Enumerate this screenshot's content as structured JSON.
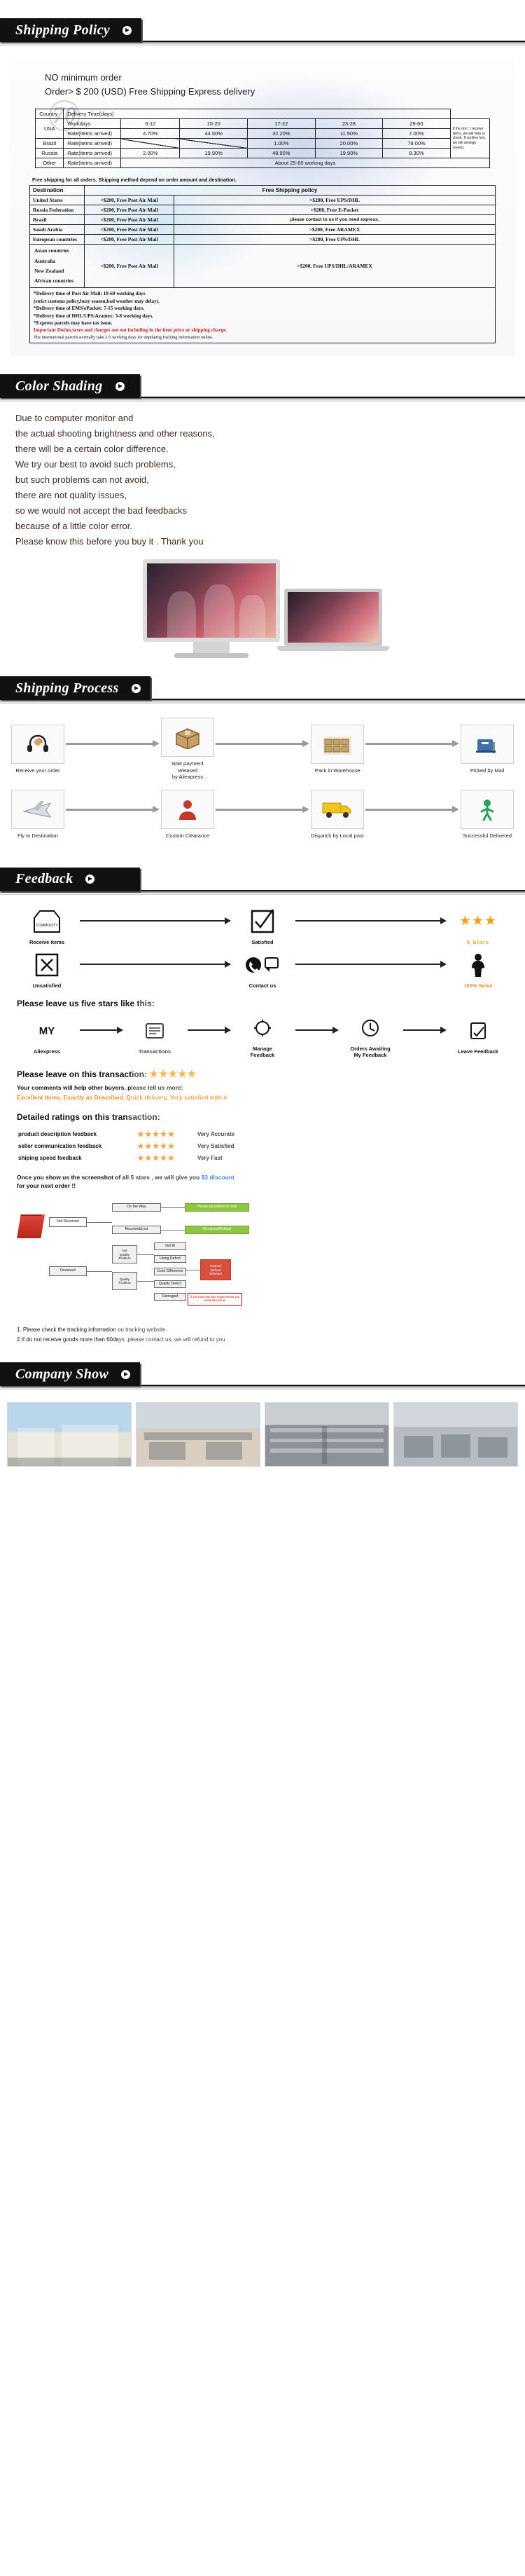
{
  "sections": {
    "shipping_policy": {
      "title": "Shipping Policy"
    },
    "color_shading": {
      "title": "Color Shading"
    },
    "shipping_process": {
      "title": "Shipping Process"
    },
    "feedback": {
      "title": "Feedback"
    },
    "company_show": {
      "title": "Company Show"
    }
  },
  "shipping": {
    "headline_1": "NO minimum order",
    "headline_2": "Order> $ 200 (USD) Free Shipping  Express delivery",
    "watermark_mark": "70",
    "watermark_text": "c w e e l",
    "rates_table": {
      "col_country": "Country",
      "col_delivery": "Delivery   Time(days)",
      "day_buckets": [
        "6-12",
        "10-20",
        "17-22",
        "23-28",
        "29-60"
      ],
      "rows": [
        {
          "country": "",
          "metric": "Workdays",
          "values": [
            "6-12",
            "10-20",
            "17-22",
            "23-28",
            "29-60"
          ]
        },
        {
          "country": "USA",
          "metric": "Rate(items arrived)",
          "values": [
            "4.70%",
            "44.50%",
            "32.20%",
            "11.50%",
            "7.00%"
          ]
        },
        {
          "country": "Brazil",
          "metric": "Rate(items arrived)",
          "values": [
            "",
            "",
            "1.00%",
            "20.00%",
            "79.00%"
          ]
        },
        {
          "country": "Russia",
          "metric": "Rate(items arrived)",
          "values": [
            "2.00%",
            "19.90%",
            "49.90%",
            "19.90%",
            "8.30%"
          ]
        },
        {
          "country": "Other",
          "metric": "Rate(items arrived)",
          "values": [
            "About 25-60 working  days"
          ]
        }
      ],
      "side_note": "If the don ' t receive items, we will help to check, If confirm lost, we will arrange resend."
    },
    "policy_note": "Free shipping for all orders. Shipping method depend on order amount and destination.",
    "policy_table": {
      "col_destination": "Destination",
      "col_policy": "Free Shipping policy",
      "rows": [
        {
          "dest": "United States",
          "under": "<$200, Free Post Air Mail",
          "over": ">$200, Free UPS/DHL"
        },
        {
          "dest": "Russia Federation",
          "under": "<$200, Free Post Air Mail",
          "over": ">$200, Free  E-Packet",
          "over_small": true
        },
        {
          "dest": "Brazil",
          "under": "<$200, Free Post Air Mail",
          "over": "please contact to us if you need express.",
          "over_small": true
        },
        {
          "dest": "Saudi Arabia",
          "under": "<$200, Free Post Air Mail",
          "over": ">$200, Free  ARAMEX"
        },
        {
          "dest": "European countries",
          "under": "<$200, Free Post Air Mail",
          "over": ">$200, Free UPS/DHL"
        },
        {
          "dest": "Asian countries\nAustralia\nNew Zealand\nAfrican countries",
          "under": "<$200, Free Post Air Mail",
          "over": ">$200, Free UPS/DHL/ARAMEX",
          "multi": true
        }
      ]
    },
    "notes": [
      "*Delivery time of Post Air Mail: 10-60 working  days",
      " (strict customs policy,busy season,bad weather may delay).",
      "*Delivery time of EMS/ePacket: 7-15 working days.",
      "*Delivery time of DHL/UPS/Aramex: 3-8 working  days.",
      "*Express parcels may have tax issue."
    ],
    "note_red": "Important Duties,taxes and charges are not including in the item price or shipping charge.",
    "note_thin": "The international parcels normally take 2-5 working days for unpdating tracking information online."
  },
  "color_shading": {
    "lines": [
      "Due to computer monitor and",
      "the actual shooting brightness and other reasons,",
      "there will be a certain color difference.",
      "We try our best to avoid such problems,",
      "but such problems can not avoid,",
      "there are not quality issues,",
      "so we would not accept the bad feedbacks",
      "because of a little color error.",
      "Please know this before you buy it . Thank you"
    ]
  },
  "process": {
    "row1": [
      {
        "icon": "headset-icon",
        "caption": "Receive your order"
      },
      {
        "icon": "package-icon",
        "caption": "Wait payment released\nby Aliexpress"
      },
      {
        "icon": "warehouse-icon",
        "caption": "Pack in Warehouse"
      },
      {
        "icon": "mail-box-icon",
        "caption": "Picked by Mail"
      }
    ],
    "row2": [
      {
        "icon": "airplane-icon",
        "caption": "Fly to Destination"
      },
      {
        "icon": "customs-icon",
        "caption": "Custom Clearance"
      },
      {
        "icon": "truck-icon",
        "caption": "Dispatch by Local post"
      },
      {
        "icon": "delivered-icon",
        "caption": "Successful Delivered"
      }
    ]
  },
  "feedback": {
    "row1": [
      {
        "icon": "receive-items-icon",
        "caption": "Receive items"
      },
      {
        "icon": "satisfied-check-icon",
        "caption": "Satisfied"
      },
      {
        "icon": "three-stars-icon",
        "caption": "5 Stars",
        "stars": "★★★"
      }
    ],
    "row2": [
      {
        "icon": "unsatisfied-icon",
        "caption": "Unsatisfied"
      },
      {
        "icon": "contact-phone-icon",
        "caption": "Contact us"
      },
      {
        "icon": "solve-icon",
        "caption": "100% Solve"
      }
    ],
    "leave_five": "Please leave us five stars like this:",
    "five_steps": [
      {
        "icon": "my-aliexpress-icon",
        "top": "MY",
        "label": "Aliexpress"
      },
      {
        "icon": "transactions-icon",
        "label": "Transactions"
      },
      {
        "icon": "manage-feedback-icon",
        "label": "Manage\nFeedback"
      },
      {
        "icon": "orders-awaiting-icon",
        "label": "Orders Awaiting\nMy Feedback"
      },
      {
        "icon": "leave-feedback-icon",
        "label": "Leave Feedback"
      }
    ],
    "transaction_title": "Please leave on this transaction:",
    "transaction_stars": "★★★★★",
    "comments_hint": "Your comments will help other buyers, please tell us more:",
    "comments_example": "Excellent items, Exactly as Described, Quick delivery, Very satisfied with it",
    "ratings_title": "Detailed ratings on this transaction:",
    "ratings": [
      {
        "label": "product description feedback",
        "stars": "★★★★★",
        "value": "Very Accurate"
      },
      {
        "label": "seller communication feedback",
        "stars": "★★★★★",
        "value": "Very Satisfied"
      },
      {
        "label": "shiping speed feedback",
        "stars": "★★★★★",
        "value": "Very Fast"
      }
    ],
    "discount_line_1a": "Once you show us the screenshot of all 5 stars , we will give you ",
    "discount_amount": "$3 discount",
    "discount_line_2": "for your next order !!",
    "flow": {
      "not_received": "Not Received",
      "received": "Received",
      "on_the_way": "On the Way",
      "be_patient": "Please be patient to wait",
      "received_lost": "Received/Lost",
      "received_refund": "Received/Refund",
      "not_fit": "Not fit",
      "not_quality_problem": "Not\nQuality\nProblem",
      "quality_problem": "Quality\nProblem",
      "using_defect": "Using Defect",
      "color_difference": "Color Difference",
      "quality_defect": "Quality Defect",
      "damaged": "Damaged",
      "resend_refund_discount": "Resend\nRefund\nDiscount",
      "returns_note": "If you have any size requirements you need,also tell us"
    },
    "closing": [
      "1. Please check the tracking information on tracking website.",
      "2.If do not receive goods more than 60days ,please contact us, we will refund to you."
    ]
  },
  "company_show": {
    "photos": [
      {
        "name": "factory-building-photo"
      },
      {
        "name": "production-line-photo"
      },
      {
        "name": "warehouse-shelves-photo"
      },
      {
        "name": "office-workers-photo"
      }
    ]
  },
  "colors": {
    "banner_bg": "#111111",
    "accent_orange": "#e8912a",
    "star_gold": "#f0a020",
    "warning_red": "#c0221b",
    "discount_blue": "#1a5fd0",
    "solve_green": "#8ec641"
  }
}
